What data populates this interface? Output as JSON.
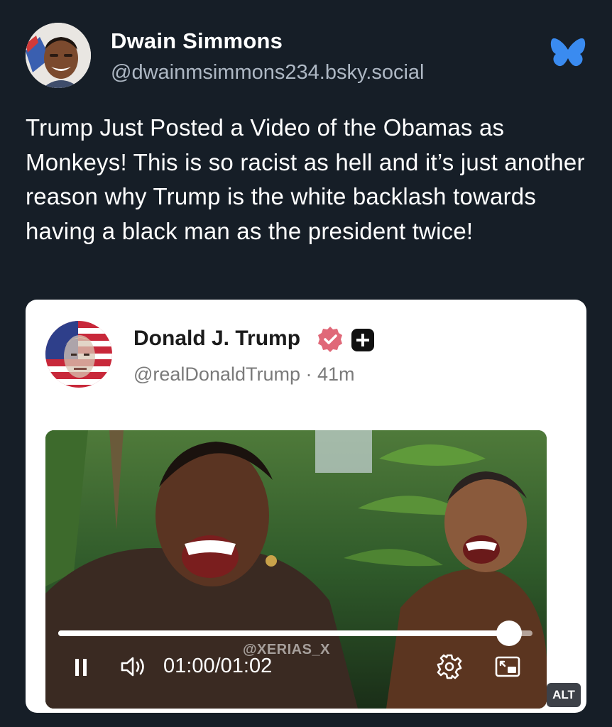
{
  "post": {
    "author_name": "Dwain Simmons",
    "author_handle": "@dwainmsimmons234.bsky.social",
    "text": "Trump Just Posted a Video of the Obamas as Monkeys! This is so racist as hell and it’s just another reason why Trump is the white backlash towards having a black man as the president twice!",
    "brand_icon": "bluesky-butterfly-icon",
    "brand_color": "#3a8bf0"
  },
  "embed": {
    "author_name": "Donald J. Trump",
    "author_handle": "@realDonaldTrump · 41m",
    "verified_color": "#e06878",
    "video": {
      "watermark": "@XERIAS_X",
      "time": "01:00/01:02",
      "progress": 0.95
    },
    "alt_badge": "ALT"
  }
}
